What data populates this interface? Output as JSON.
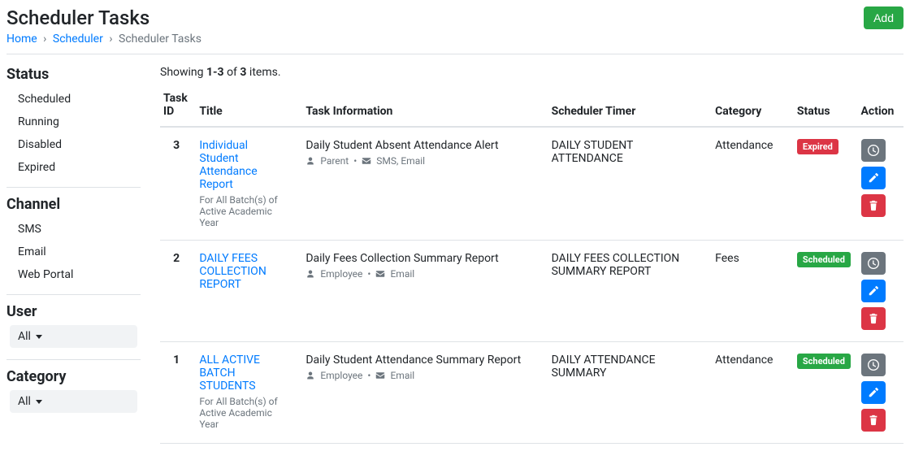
{
  "header": {
    "title": "Scheduler Tasks",
    "add_label": "Add",
    "breadcrumb": {
      "home": "Home",
      "scheduler": "Scheduler",
      "current": "Scheduler Tasks"
    }
  },
  "sidebar": {
    "status_heading": "Status",
    "status_items": [
      "Scheduled",
      "Running",
      "Disabled",
      "Expired"
    ],
    "channel_heading": "Channel",
    "channel_items": [
      "SMS",
      "Email",
      "Web Portal"
    ],
    "user_heading": "User",
    "user_value": "All",
    "category_heading": "Category",
    "category_value": "All"
  },
  "summary": {
    "prefix": "Showing ",
    "range": "1-3",
    "mid": " of ",
    "total": "3",
    "suffix": " items."
  },
  "columns": {
    "task_id": "Task ID",
    "title": "Title",
    "info": "Task Information",
    "timer": "Scheduler Timer",
    "category": "Category",
    "status": "Status",
    "action": "Action"
  },
  "rows": [
    {
      "id": "3",
      "title": "Individual Student Attendance Report",
      "title_sub": "For All Batch(s) of Active Academic Year",
      "info": "Daily Student Absent Attendance Alert",
      "info_recipient": "Parent",
      "info_channels": "SMS, Email",
      "timer": "DAILY STUDENT ATTENDANCE",
      "category": "Attendance",
      "status": "Expired",
      "status_class": "badge-expired"
    },
    {
      "id": "2",
      "title": "DAILY FEES COLLECTION REPORT",
      "title_sub": "",
      "info": "Daily Fees Collection Summary Report",
      "info_recipient": "Employee",
      "info_channels": "Email",
      "timer": "DAILY FEES COLLECTION SUMMARY REPORT",
      "category": "Fees",
      "status": "Scheduled",
      "status_class": "badge-scheduled"
    },
    {
      "id": "1",
      "title": "ALL ACTIVE BATCH STUDENTS",
      "title_sub": "For All Batch(s) of Active Academic Year",
      "info": "Daily Student Attendance Summary Report",
      "info_recipient": "Employee",
      "info_channels": "Email",
      "timer": "DAILY ATTENDANCE SUMMARY",
      "category": "Attendance",
      "status": "Scheduled",
      "status_class": "badge-scheduled"
    }
  ],
  "icons": {
    "clock": "clock-icon",
    "edit": "edit-icon",
    "trash": "trash-icon",
    "user": "user-icon",
    "envelope": "envelope-icon"
  }
}
